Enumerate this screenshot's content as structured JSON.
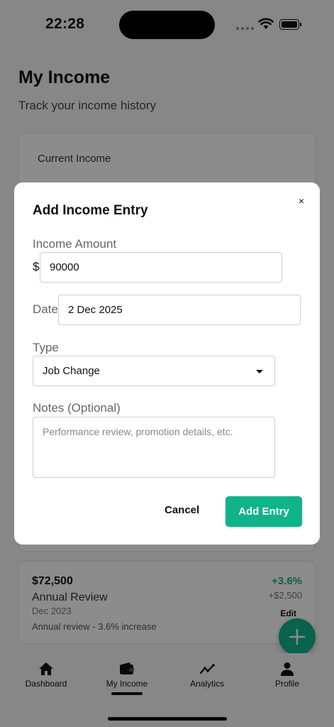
{
  "status": {
    "time": "22:28"
  },
  "page": {
    "title": "My Income",
    "subtitle": "Track your income history"
  },
  "current_card": {
    "label": "Current Income"
  },
  "entry": {
    "amount": "$72,500",
    "type": "Annual Review",
    "date": "Dec 2023",
    "note": "Annual review - 3.6% increase",
    "change_pct": "+3.6%",
    "change_abs": "+$2,500",
    "edit_label": "Edit"
  },
  "tabs": [
    {
      "label": "Dashboard",
      "icon": "home-icon"
    },
    {
      "label": "My Income",
      "icon": "wallet-icon"
    },
    {
      "label": "Analytics",
      "icon": "chart-line-icon"
    },
    {
      "label": "Profile",
      "icon": "person-icon"
    }
  ],
  "modal": {
    "title": "Add Income Entry",
    "close": "×",
    "amount_label": "Income Amount",
    "currency": "$",
    "amount_value": "90000",
    "date_label": "Date",
    "date_value": "2 Dec 2025",
    "type_label": "Type",
    "type_value": "Job Change",
    "notes_label": "Notes (Optional)",
    "notes_placeholder": "Performance review, promotion details, etc.",
    "cancel": "Cancel",
    "submit": "Add Entry"
  },
  "colors": {
    "accent": "#10b38a",
    "positive": "#10b38a"
  }
}
